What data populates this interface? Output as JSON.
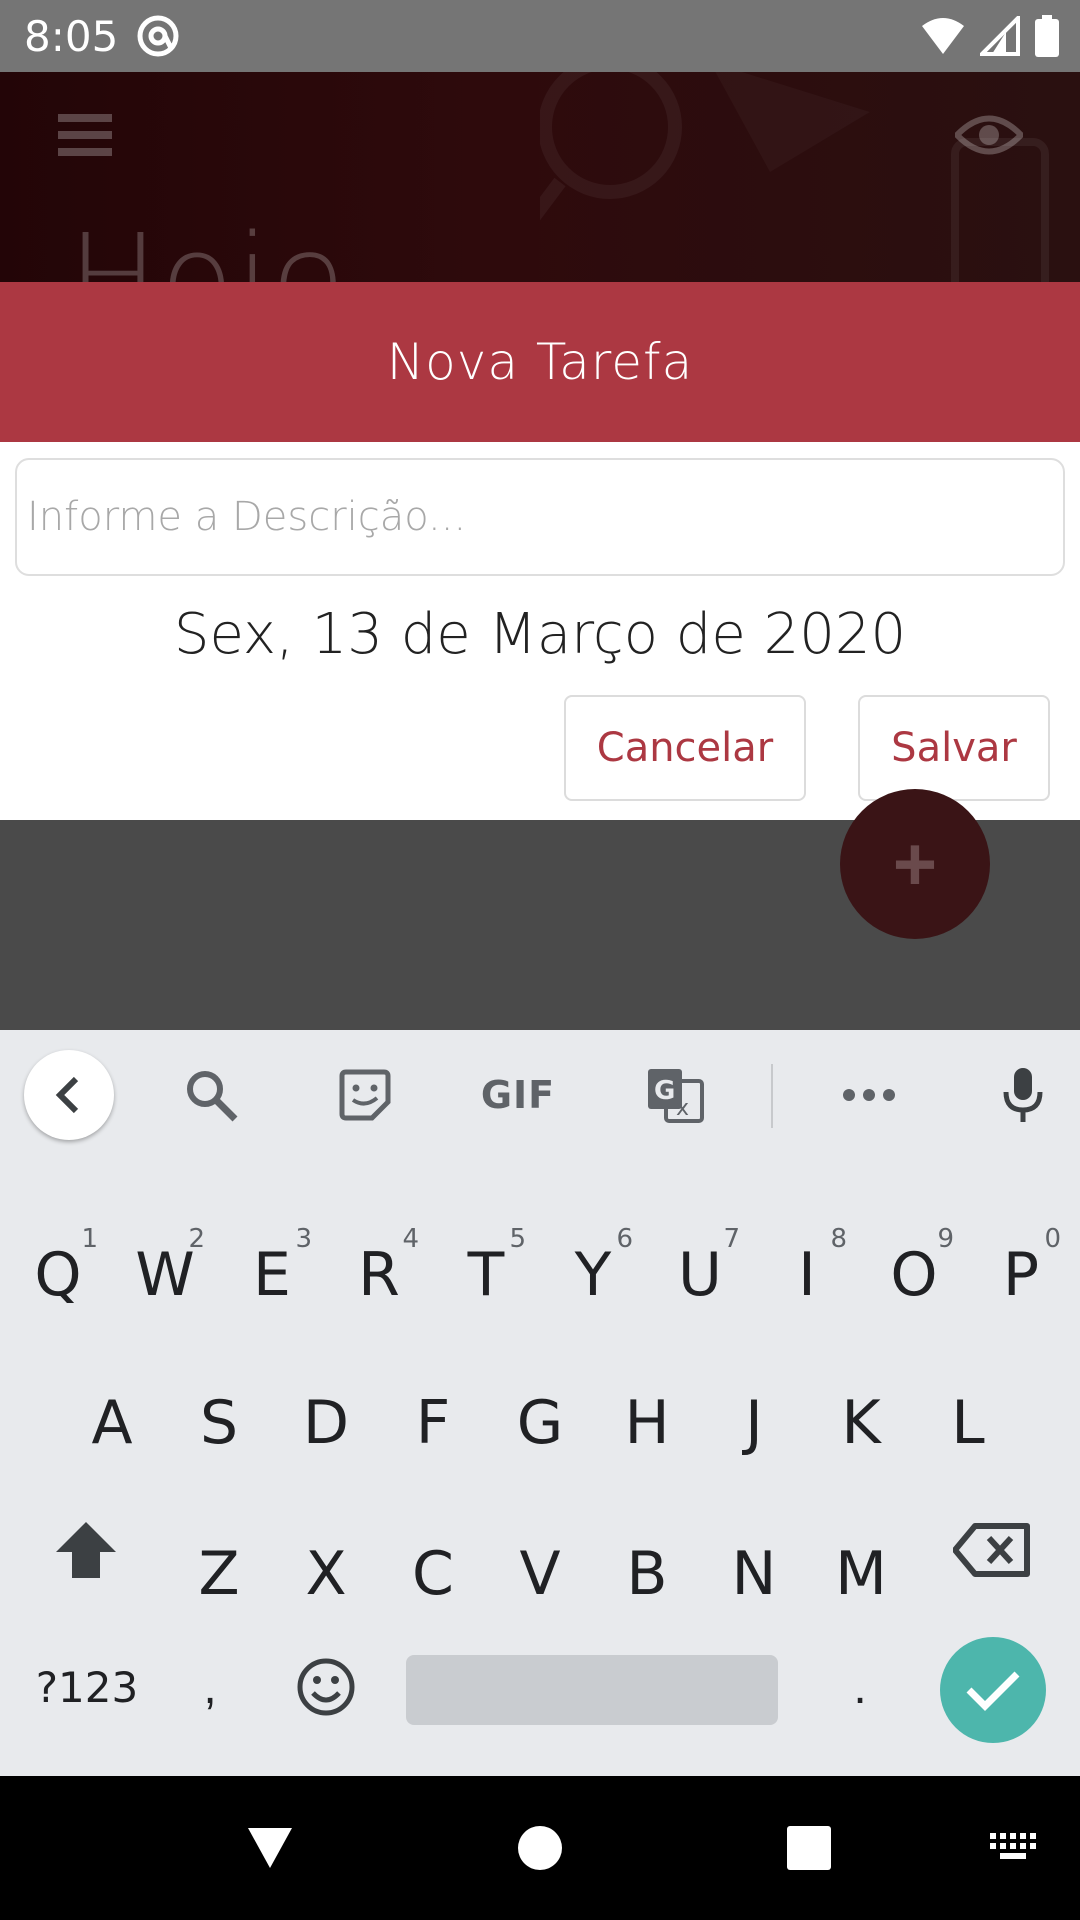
{
  "status_bar": {
    "time": "8:05"
  },
  "app_header": {
    "title_partial": "Hoje"
  },
  "dialog": {
    "title": "Nova Tarefa",
    "description_placeholder": "Informe a Descrição...",
    "description_value": "",
    "date": "Sex, 13 de Março de 2020",
    "cancel_label": "Cancelar",
    "save_label": "Salvar"
  },
  "fab": {
    "label": "+"
  },
  "keyboard": {
    "toolbar": [
      "back",
      "search",
      "sticker",
      "GIF",
      "translate",
      "more",
      "mic"
    ],
    "gif_label": "GIF",
    "row1": [
      {
        "key": "Q",
        "num": "1"
      },
      {
        "key": "W",
        "num": "2"
      },
      {
        "key": "E",
        "num": "3"
      },
      {
        "key": "R",
        "num": "4"
      },
      {
        "key": "T",
        "num": "5"
      },
      {
        "key": "Y",
        "num": "6"
      },
      {
        "key": "U",
        "num": "7"
      },
      {
        "key": "I",
        "num": "8"
      },
      {
        "key": "O",
        "num": "9"
      },
      {
        "key": "P",
        "num": "0"
      }
    ],
    "row2": [
      "A",
      "S",
      "D",
      "F",
      "G",
      "H",
      "J",
      "K",
      "L"
    ],
    "row3": [
      "Z",
      "X",
      "C",
      "V",
      "B",
      "N",
      "M"
    ],
    "symbols_label": "?123",
    "comma_label": ",",
    "period_label": "."
  },
  "colors": {
    "accent": "#ac3842",
    "enter_key": "#4db6ac",
    "keyboard_bg": "#e8eaed",
    "overlay": "#4a4a4a"
  },
  "icons": {
    "status_app": "at-sign-icon",
    "wifi": "wifi-icon",
    "signal": "signal-icon",
    "battery": "battery-icon",
    "menu": "hamburger-menu-icon",
    "visibility": "eye-icon",
    "nav_back": "triangle-back-icon",
    "nav_home": "circle-home-icon",
    "nav_recents": "square-recents-icon",
    "nav_keyboard": "keyboard-switch-icon"
  }
}
